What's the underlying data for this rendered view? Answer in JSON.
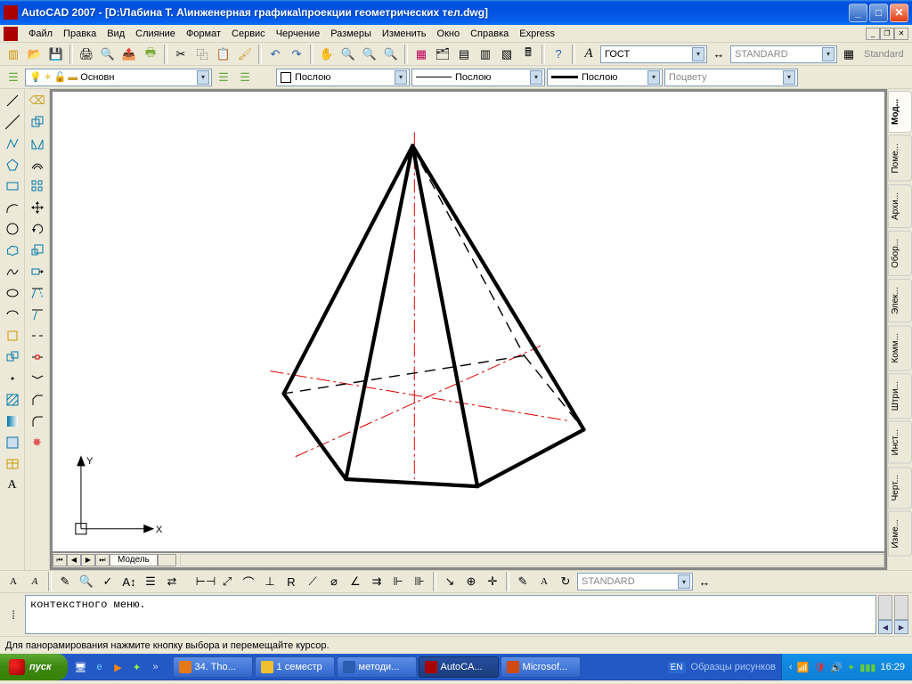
{
  "title": "AutoCAD 2007 - [D:\\Лабина Т. А\\инженерная графика\\проекции геометрических тел.dwg]",
  "menu": [
    "Файл",
    "Правка",
    "Вид",
    "Слияние",
    "Формат",
    "Сервис",
    "Черчение",
    "Размеры",
    "Изменить",
    "Окно",
    "Справка",
    "Express"
  ],
  "layer_combo": "Основн",
  "color_combo": "Послою",
  "ltype_combo": "Послою",
  "lweight_combo": "Послою",
  "plot_combo": "Поцвету",
  "tstyle1": "ГОСТ",
  "tstyle2": "STANDARD",
  "tstyle3": "Standard",
  "dstyle": "STANDARD",
  "model_tab": "Модель",
  "vtabs": [
    "Мод...",
    "Поме...",
    "Архи...",
    "Обор...",
    "Элек...",
    "Комм...",
    "Штри...",
    "Инст...",
    "Черт...",
    "Изме..."
  ],
  "cmd_text": "контекстного меню.",
  "status": "Для панорамирования нажмите кнопку выбора и перемещайте курсор.",
  "axis_x": "X",
  "axis_y": "Y",
  "start": "пуск",
  "tasks": [
    {
      "label": "34. Tho...",
      "color": "#e67817"
    },
    {
      "label": "1 семестр",
      "color": "#f0c030"
    },
    {
      "label": "методи...",
      "color": "#2a5db0"
    },
    {
      "label": "AutoCA...",
      "color": "#a00",
      "active": true
    },
    {
      "label": "Microsof...",
      "color": "#d04a10"
    }
  ],
  "lang": "EN",
  "deskband": "Образцы рисунков",
  "clock": "16:29"
}
